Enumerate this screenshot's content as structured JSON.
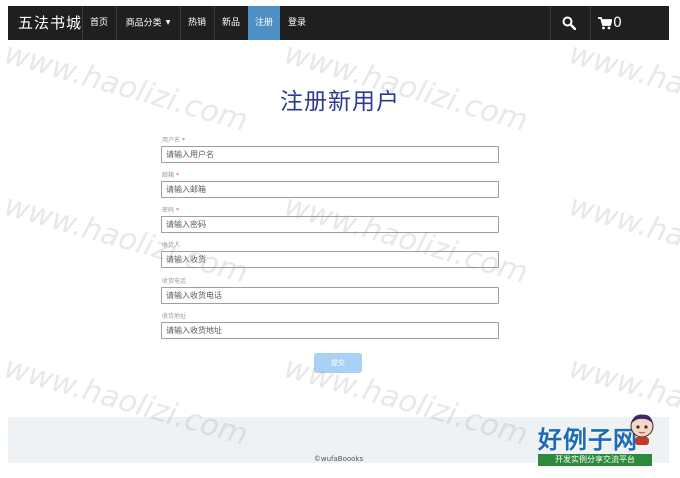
{
  "navbar": {
    "brand": "五法书城",
    "items": [
      {
        "label": "首页"
      },
      {
        "label": "商品分类"
      },
      {
        "label": "热销"
      },
      {
        "label": "新品"
      },
      {
        "label": "注册"
      },
      {
        "label": "登录"
      }
    ],
    "cart_count": "0"
  },
  "page": {
    "title": "注册新用户"
  },
  "form": {
    "fields": [
      {
        "label": "用户名",
        "required": "*",
        "placeholder": "请输入用户名"
      },
      {
        "label": "邮箱",
        "required": "*",
        "placeholder": "请输入邮箱"
      },
      {
        "label": "密码",
        "required": "*",
        "placeholder": "请输入密码"
      },
      {
        "label": "收货人",
        "required": "",
        "placeholder": "请输入收货"
      },
      {
        "label": "收货电话",
        "required": "",
        "placeholder": "请输入收货电话"
      },
      {
        "label": "收货地址",
        "required": "",
        "placeholder": "请输入收货地址"
      }
    ],
    "submit_label": "提交"
  },
  "footer": {
    "copyright": "©wufaBoooks"
  },
  "watermark": {
    "text": "www.haolizi.com",
    "logo_main": "好例子网",
    "logo_sub": "开发实例分享交流平台"
  },
  "colors": {
    "navbar_bg": "#1f1f1f",
    "active_tab": "#4f8fc6",
    "title": "#2f3a8f",
    "submit": "#a9d1f5",
    "required": "#d9534f",
    "footer_bg": "#eef2f5"
  }
}
